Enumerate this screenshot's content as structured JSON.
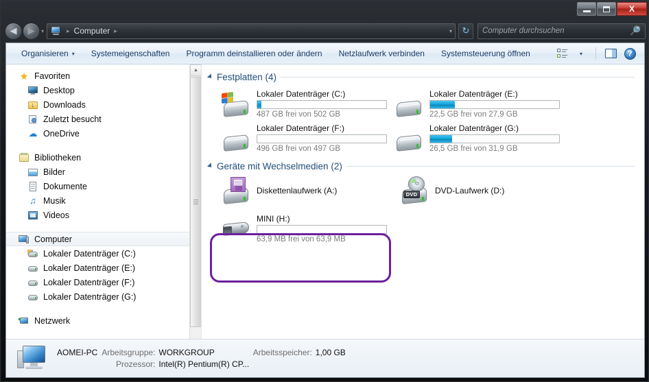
{
  "window": {
    "controls": {
      "minimize": "Minimieren",
      "maximize": "Maximieren",
      "close": "Schließen",
      "close_glyph": "X"
    }
  },
  "nav": {
    "back_label": "Zurück",
    "forward_label": "Vorwärts",
    "history_dropdown": "▾",
    "breadcrumb": {
      "root": "Computer",
      "sep": "▸"
    },
    "address_dropdown": "▾",
    "refresh_label": "↻",
    "search": {
      "placeholder": "Computer durchsuchen",
      "value": ""
    }
  },
  "toolbar": {
    "organize": "Organisieren",
    "organize_caret": "▾",
    "system_properties": "Systemeigenschaften",
    "uninstall": "Programm deinstallieren oder ändern",
    "map_drive": "Netzlaufwerk verbinden",
    "control_panel": "Systemsteuerung öffnen",
    "view_caret": "▾",
    "help_glyph": "?"
  },
  "sidebar": {
    "groups": [
      {
        "header": "Favoriten",
        "header_icon": "star-icon",
        "items": [
          {
            "label": "Desktop",
            "icon": "desktop-icon"
          },
          {
            "label": "Downloads",
            "icon": "downloads-icon"
          },
          {
            "label": "Zuletzt besucht",
            "icon": "recent-places-icon"
          },
          {
            "label": "OneDrive",
            "icon": "onedrive-cloud-icon"
          }
        ]
      },
      {
        "header": "Bibliotheken",
        "header_icon": "libraries-icon",
        "items": [
          {
            "label": "Bilder",
            "icon": "pictures-icon"
          },
          {
            "label": "Dokumente",
            "icon": "documents-icon"
          },
          {
            "label": "Musik",
            "icon": "music-icon"
          },
          {
            "label": "Videos",
            "icon": "videos-icon"
          }
        ]
      },
      {
        "header": "Computer",
        "header_icon": "computer-icon",
        "selected": true,
        "items": [
          {
            "label": "Lokaler Datenträger (C:)",
            "icon": "hdd-windows-icon"
          },
          {
            "label": "Lokaler Datenträger (E:)",
            "icon": "hdd-icon"
          },
          {
            "label": "Lokaler Datenträger (F:)",
            "icon": "hdd-icon"
          },
          {
            "label": "Lokaler Datenträger (G:)",
            "icon": "hdd-icon"
          }
        ]
      },
      {
        "header": "Netzwerk",
        "header_icon": "network-icon",
        "items": []
      }
    ]
  },
  "main": {
    "sections": [
      {
        "title": "Festplatten (4)",
        "type": "drives",
        "items": [
          {
            "name": "Lokaler Datenträger (C:)",
            "free_text": "487 GB frei von 502 GB",
            "free": "487 GB",
            "total": "502 GB",
            "used_percent": 3,
            "icon": "hdd-windows-icon",
            "bar_color": "#13a8e0"
          },
          {
            "name": "Lokaler Datenträger (E:)",
            "free_text": "22,5 GB frei von 27,9 GB",
            "free": "22,5 GB",
            "total": "27,9 GB",
            "used_percent": 19,
            "icon": "hdd-icon",
            "bar_color": "#13a8e0"
          },
          {
            "name": "Lokaler Datenträger (F:)",
            "free_text": "496 GB frei von 497 GB",
            "free": "496 GB",
            "total": "497 GB",
            "used_percent": 0,
            "icon": "hdd-icon",
            "bar_color": "#13a8e0"
          },
          {
            "name": "Lokaler Datenträger (G:)",
            "free_text": "26,5 GB frei von 31,9 GB",
            "free": "26,5 GB",
            "total": "31,9 GB",
            "used_percent": 17,
            "icon": "hdd-icon",
            "bar_color": "#13a8e0"
          }
        ]
      },
      {
        "title": "Geräte mit Wechselmedien (2)",
        "type": "removable",
        "items": [
          {
            "name": "Diskettenlaufwerk (A:)",
            "icon": "floppy-drive-icon",
            "has_bar": false
          },
          {
            "name": "DVD-Laufwerk (D:)",
            "icon": "dvd-drive-icon",
            "badge": "DVD",
            "has_bar": false
          },
          {
            "name": "MINI (H:)",
            "icon": "usb-drive-icon",
            "has_bar": true,
            "free_text": "63,9 MB frei von 63,9 MB",
            "free": "63,9 MB",
            "total": "63,9 MB",
            "used_percent": 0,
            "highlighted": true
          }
        ]
      }
    ]
  },
  "status": {
    "computer_name": "AOMEI-PC",
    "workgroup_label": "Arbeitsgruppe:",
    "workgroup_value": "WORKGROUP",
    "memory_label": "Arbeitsspeicher:",
    "memory_value": "1,00 GB",
    "cpu_label": "Prozessor:",
    "cpu_value": "Intel(R) Pentium(R) CP..."
  },
  "colors": {
    "accent_blue": "#1f4e79",
    "bar_fill": "#13a8e0",
    "highlight_purple": "#6b1f9e",
    "close_red": "#c63a31"
  }
}
